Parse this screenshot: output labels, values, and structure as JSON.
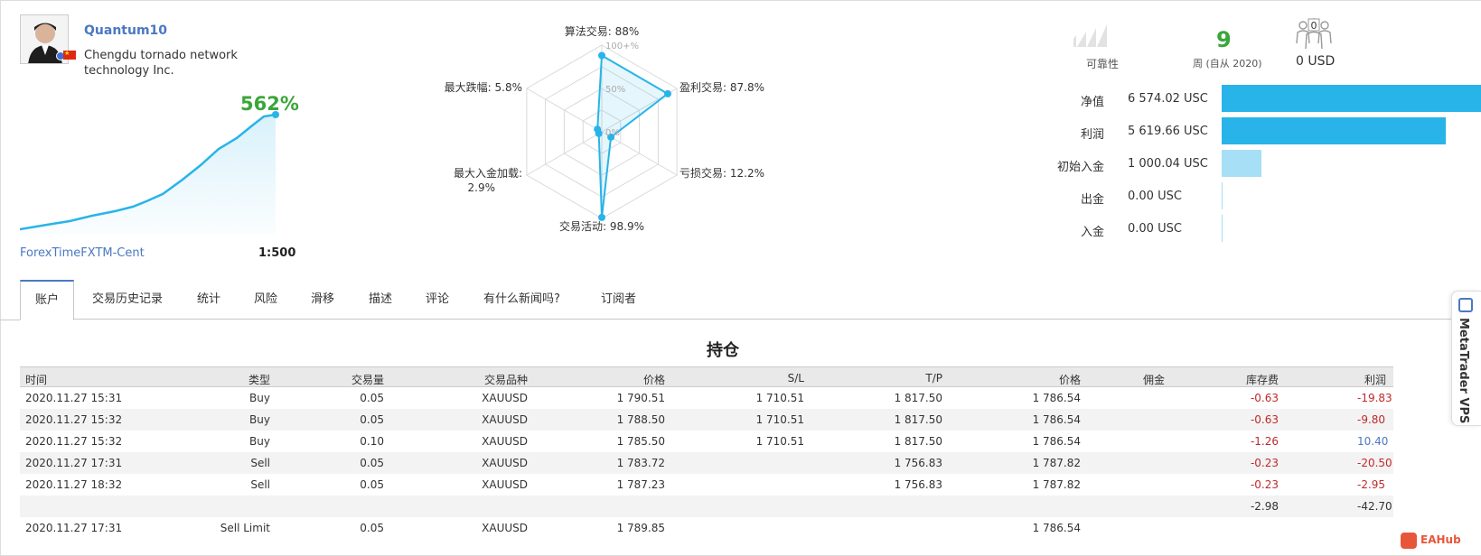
{
  "profile": {
    "name": "Quantum10",
    "company": "Chengdu tornado network technology Inc.",
    "growth": "562%",
    "broker": "ForexTimeFXTM-Cent",
    "leverage": "1:500"
  },
  "radar": {
    "labels": {
      "algo": "算法交易: 88%",
      "profit": "盈利交易: 87.8%",
      "loss": "亏损交易: 12.2%",
      "activity": "交易活动: 98.9%",
      "deposit_load_1": "最大入金加载:",
      "deposit_load_2": "2.9%",
      "drawdown": "最大跌幅: 5.8%"
    },
    "ticks": {
      "t100": "100+%",
      "t50": "50%",
      "t0": "0%"
    },
    "values": {
      "algo": 88,
      "profit": 87.8,
      "loss": 12.2,
      "activity": 98.9,
      "deposit_load": 2.9,
      "drawdown": 5.8
    }
  },
  "stats": {
    "reliability_label": "可靠性",
    "weeks": "9",
    "weeks_label": "周 (自从 2020)",
    "subscribers_count": "0",
    "subscribers_value": "0 USD",
    "colors": {
      "accent": "#4a78c2",
      "green": "#3aa63a",
      "bar": "#28b4e8",
      "bar_light": "#a7dff6",
      "negative": "#c0292a"
    }
  },
  "financials": [
    {
      "label": "净值",
      "value": "6 574.02 USC",
      "amount": 6574.02
    },
    {
      "label": "利润",
      "value": "5 619.66 USC",
      "amount": 5619.66
    },
    {
      "label": "初始入金",
      "value": "1 000.04 USC",
      "amount": 1000.04
    },
    {
      "label": "出金",
      "value": "0.00 USC",
      "amount": 0
    },
    {
      "label": "入金",
      "value": "0.00 USC",
      "amount": 0
    }
  ],
  "tabs": [
    "账户",
    "交易历史记录",
    "统计",
    "风险",
    "滑移",
    "描述",
    "评论",
    "有什么新闻吗?",
    "订阅者"
  ],
  "positions": {
    "title": "持仓",
    "headers": [
      "时间",
      "类型",
      "交易量",
      "交易品种",
      "价格",
      "S/L",
      "T/P",
      "价格",
      "佣金",
      "库存费",
      "利润"
    ],
    "rows": [
      [
        "2020.11.27 15:31",
        "Buy",
        "0.05",
        "XAUUSD",
        "1 790.51",
        "1 710.51",
        "1 817.50",
        "1 786.54",
        "",
        "-0.63",
        "-19.83"
      ],
      [
        "2020.11.27 15:32",
        "Buy",
        "0.05",
        "XAUUSD",
        "1 788.50",
        "1 710.51",
        "1 817.50",
        "1 786.54",
        "",
        "-0.63",
        "-9.80"
      ],
      [
        "2020.11.27 15:32",
        "Buy",
        "0.10",
        "XAUUSD",
        "1 785.50",
        "1 710.51",
        "1 817.50",
        "1 786.54",
        "",
        "-1.26",
        "10.40"
      ],
      [
        "2020.11.27 17:31",
        "Sell",
        "0.05",
        "XAUUSD",
        "1 783.72",
        "",
        "1 756.83",
        "1 787.82",
        "",
        "-0.23",
        "-20.50"
      ],
      [
        "2020.11.27 18:32",
        "Sell",
        "0.05",
        "XAUUSD",
        "1 787.23",
        "",
        "1 756.83",
        "1 787.82",
        "",
        "-0.23",
        "-2.95"
      ],
      [
        "",
        "",
        "",
        "",
        "",
        "",
        "",
        "",
        "",
        "-2.98",
        "-42.70"
      ],
      [
        "2020.11.27 17:31",
        "Sell Limit",
        "0.05",
        "XAUUSD",
        "1 789.85",
        "",
        "",
        "1 786.54",
        "",
        "",
        ""
      ]
    ]
  },
  "side_tab": {
    "label": "MetaTrader VPS"
  },
  "watermark": "EAHub"
}
